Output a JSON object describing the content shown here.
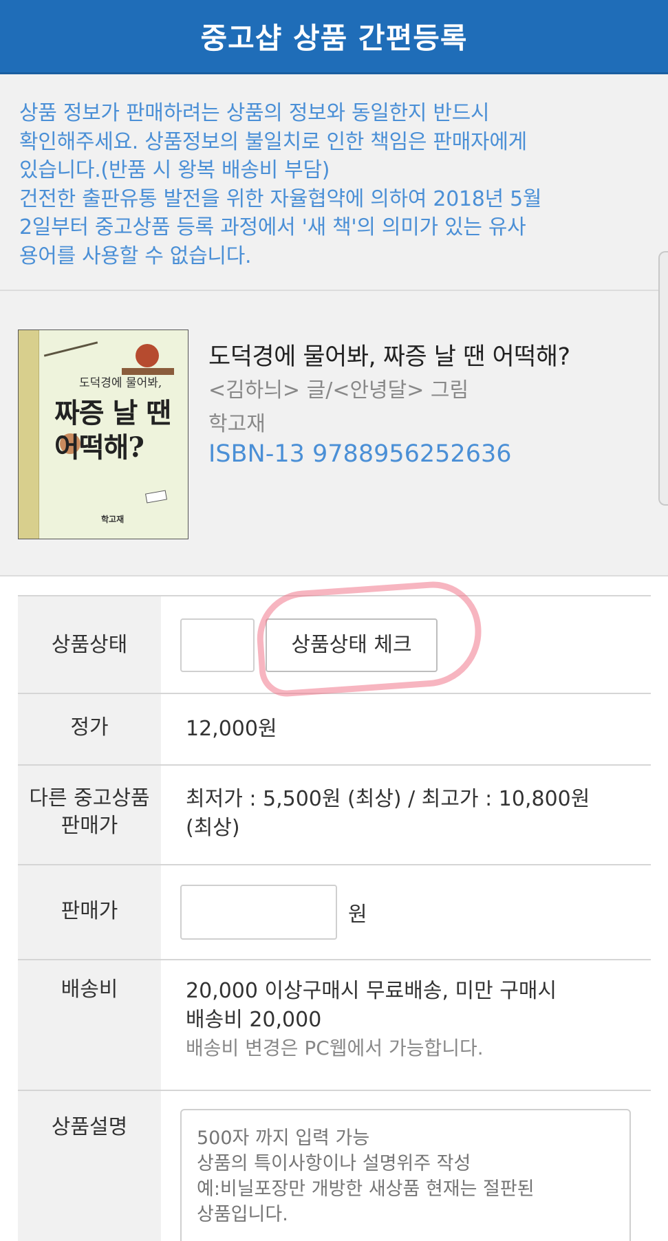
{
  "header": {
    "title": "중고샵 상품 간편등록"
  },
  "notice": {
    "line1": "상품 정보가 판매하려는 상품의 정보와 동일한지 반드시",
    "line2": "확인해주세요. 상품정보의 불일치로 인한 책임은 판매자에게",
    "line3": "있습니다.(반품 시 왕복 배송비 부담)",
    "line4": "건전한 출판유통 발전을 위한 자율협약에 의하여 2018년 5월",
    "line5": "2일부터 중고상품 등록 과정에서 '새 책'의 의미가 있는 유사",
    "line6": "용어를 사용할 수 없습니다."
  },
  "product": {
    "cover_line1": "도덕경에 물어봐,",
    "cover_line2": "짜증 날 땐",
    "cover_line3": "어떡해?",
    "cover_publisher": "학고재",
    "title": "도덕경에 물어봐, 짜증 날 땐 어떡해?",
    "author": "<김하늬> 글/<안녕달> 그림",
    "publisher": "학고재",
    "isbn": "ISBN-13 9788956252636"
  },
  "form": {
    "condition_label": "상품상태",
    "condition_button": "상품상태 체크",
    "list_price_label": "정가",
    "list_price": "12,000원",
    "other_label_1": "다른 중고상품",
    "other_label_2": "판매가",
    "other_price_1": "최저가 : 5,500원 (최상) / 최고가 : 10,800원",
    "other_price_2": "(최상)",
    "sale_price_label": "판매가",
    "sale_price_unit": "원",
    "shipping_label": "배송비",
    "shipping_1": "20,000 이상구매시 무료배송, 미만 구매시",
    "shipping_2": "배송비 20,000",
    "shipping_note": "배송비 변경은 PC웹에서 가능합니다.",
    "desc_label": "상품설명",
    "desc_placeholder": "500자 까지 입력 가능\n상품의 특이사항이나 설명위주 작성\n예:비닐포장만 개방한 새상품 현재는 절판된\n상품입니다."
  },
  "colors": {
    "header_bg": "#1f6db8",
    "notice_text": "#4a8fd6",
    "isbn_text": "#4a8fd6",
    "annotation": "#f0788c"
  }
}
